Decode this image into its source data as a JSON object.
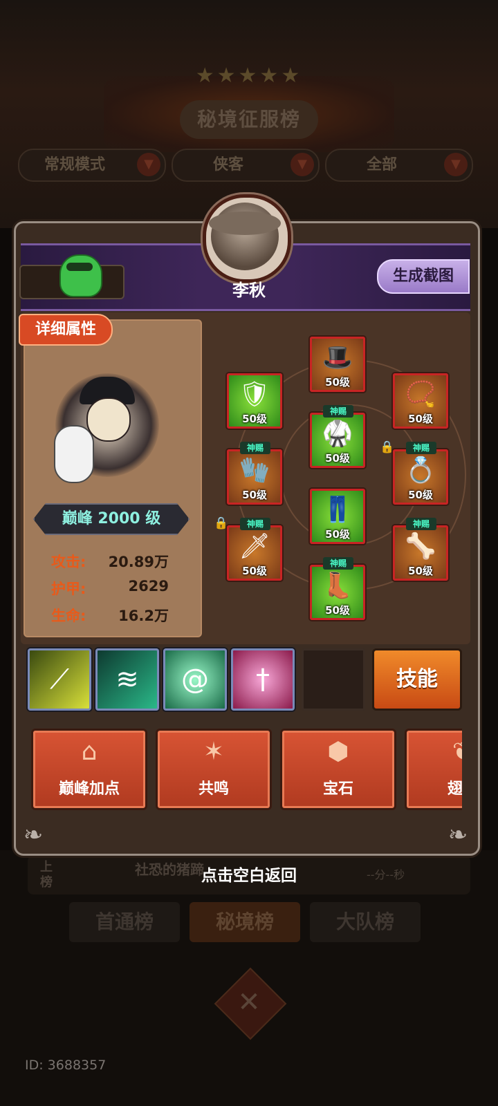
{
  "background": {
    "title": "秘境征服榜",
    "stars": "★★★★★",
    "filters": [
      {
        "label": "常规模式"
      },
      {
        "label": "侠客"
      },
      {
        "label": "全部"
      }
    ],
    "rank_row": {
      "rank": "上榜",
      "name": "社恐的猪蹄",
      "time": "--分--秒"
    },
    "tabs": [
      "首通榜",
      "秘境榜",
      "大队榜"
    ],
    "user_id": "ID: 3688357"
  },
  "player": {
    "name": "李秋",
    "screenshot_button": "生成截图",
    "detail_tag": "详细属性",
    "level_badge": "巅峰 2000 级",
    "stats": [
      {
        "label": "攻击:",
        "value": "20.89万"
      },
      {
        "label": "护甲:",
        "value": "2629"
      },
      {
        "label": "生命:",
        "value": "16.2万"
      }
    ]
  },
  "equipment": [
    {
      "slot": "hat",
      "icon": "hat-icon",
      "level": "50级",
      "gift": "",
      "rarity": "gold",
      "locked": false
    },
    {
      "slot": "shoulder",
      "icon": "shoulder-armor-icon",
      "level": "50级",
      "gift": "",
      "rarity": "green",
      "locked": false
    },
    {
      "slot": "necklace",
      "icon": "necklace-icon",
      "level": "50级",
      "gift": "",
      "rarity": "gold",
      "locked": false
    },
    {
      "slot": "robe",
      "icon": "robe-icon",
      "level": "50级",
      "gift": "神赐",
      "rarity": "green",
      "locked": false
    },
    {
      "slot": "bracer",
      "icon": "bracer-icon",
      "level": "50级",
      "gift": "神赐",
      "rarity": "gold",
      "locked": false
    },
    {
      "slot": "ring",
      "icon": "jade-ring-icon",
      "level": "50级",
      "gift": "神赐",
      "rarity": "gold",
      "locked": true
    },
    {
      "slot": "pants",
      "icon": "pants-icon",
      "level": "50级",
      "gift": "",
      "rarity": "green",
      "locked": false
    },
    {
      "slot": "weapon",
      "icon": "sword-icon",
      "level": "50级",
      "gift": "神赐",
      "rarity": "gold",
      "locked": true
    },
    {
      "slot": "charm",
      "icon": "charm-icon",
      "level": "50级",
      "gift": "神赐",
      "rarity": "gold",
      "locked": false
    },
    {
      "slot": "boots",
      "icon": "boots-icon",
      "level": "50级",
      "gift": "神赐",
      "rarity": "green",
      "locked": false
    }
  ],
  "skills": [
    {
      "icon": "yellow-slash-icon",
      "color": "#d8e03a"
    },
    {
      "icon": "green-wave-icon",
      "color": "#2ab888"
    },
    {
      "icon": "green-vortex-icon",
      "color": "#3aa878"
    },
    {
      "icon": "pink-sword-icon",
      "color": "#e03a8a"
    }
  ],
  "skill_button": "技能",
  "actions": [
    {
      "label": "巅峰加点",
      "icon": "plus-house-icon"
    },
    {
      "label": "共鸣",
      "icon": "resonance-icon"
    },
    {
      "label": "宝石",
      "icon": "gem-icon"
    },
    {
      "label": "翅膀",
      "icon": "wing-icon"
    }
  ],
  "return_hint": "点击空白返回"
}
